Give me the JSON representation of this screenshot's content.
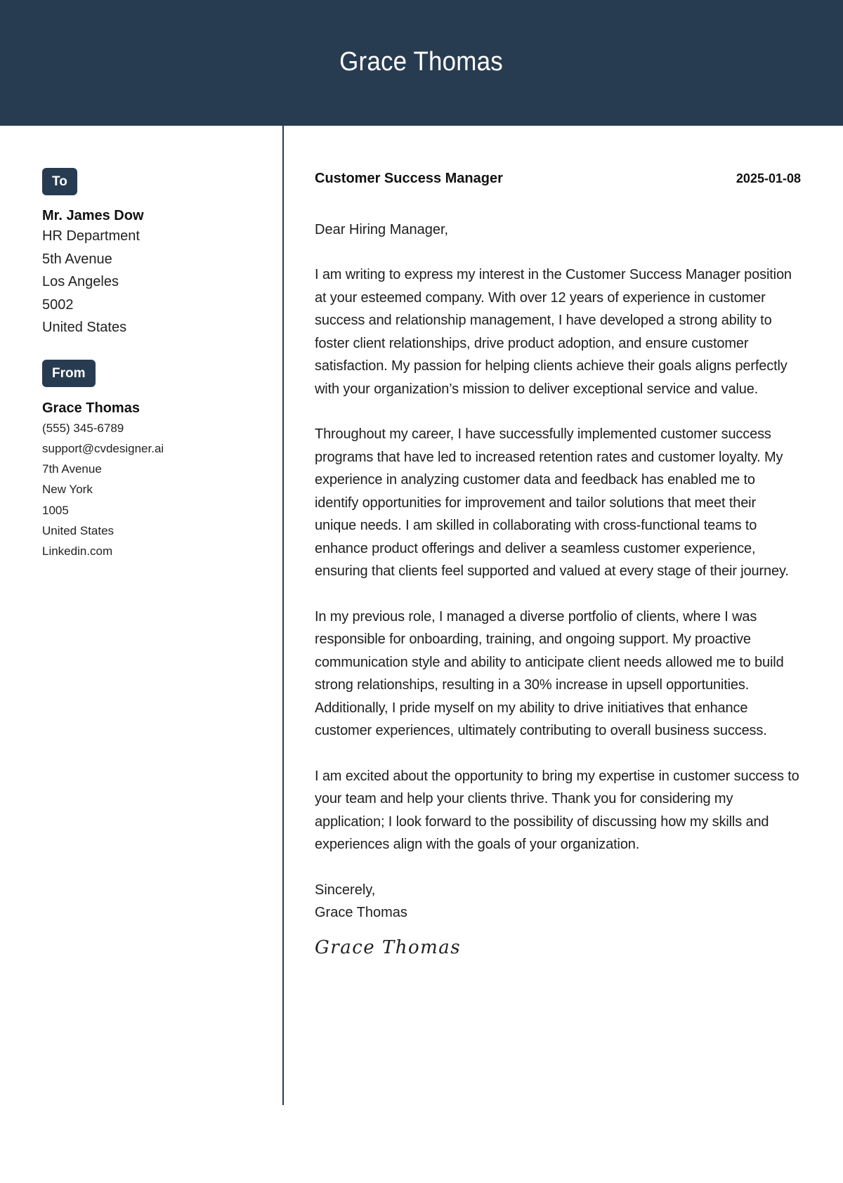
{
  "header": {
    "name": "Grace Thomas"
  },
  "colors": {
    "primary": "#283c51",
    "text": "#1e1e1e",
    "background": "#ffffff"
  },
  "recipient": {
    "badge_label": "To",
    "name": "Mr. James Dow",
    "lines": [
      "HR Department",
      "5th Avenue",
      "Los Angeles",
      "5002",
      "United States"
    ]
  },
  "sender": {
    "badge_label": "From",
    "name": "Grace Thomas",
    "lines": [
      "(555) 345-6789",
      "support@cvdesigner.ai",
      "7th Avenue",
      "New York",
      "1005",
      "United States",
      "Linkedin.com"
    ]
  },
  "letter": {
    "position": "Customer Success Manager",
    "date": "2025-01-08",
    "salutation": "Dear Hiring Manager,",
    "paragraphs": [
      "I am writing to express my interest in the Customer Success Manager position at your esteemed company. With over 12 years of experience in customer success and relationship management, I have developed a strong ability to foster client relationships, drive product adoption, and ensure customer satisfaction. My passion for helping clients achieve their goals aligns perfectly with your organization’s mission to deliver exceptional service and value.",
      "Throughout my career, I have successfully implemented customer success programs that have led to increased retention rates and customer loyalty. My experience in analyzing customer data and feedback has enabled me to identify opportunities for improvement and tailor solutions that meet their unique needs. I am skilled in collaborating with cross-functional teams to enhance product offerings and deliver a seamless customer experience, ensuring that clients feel supported and valued at every stage of their journey.",
      "In my previous role, I managed a diverse portfolio of clients, where I was responsible for onboarding, training, and ongoing support. My proactive communication style and ability to anticipate client needs allowed me to build strong relationships, resulting in a 30% increase in upsell opportunities. Additionally, I pride myself on my ability to drive initiatives that enhance customer experiences, ultimately contributing to overall business success.",
      "I am excited about the opportunity to bring my expertise in customer success to your team and help your clients thrive. Thank you for considering my application; I look forward to the possibility of discussing how my skills and experiences align with the goals of your organization."
    ],
    "closing": "Sincerely,",
    "closing_name": "Grace Thomas",
    "signature": "Grace Thomas"
  }
}
